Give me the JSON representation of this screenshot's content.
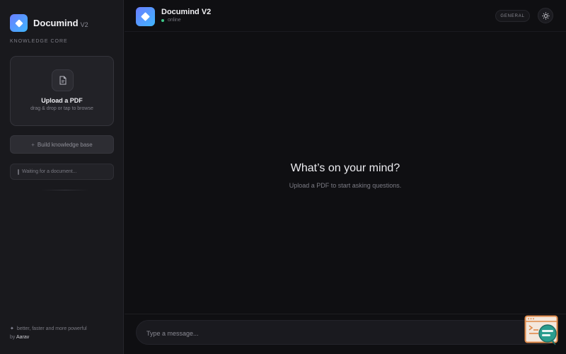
{
  "sidebar": {
    "brand_name": "Documind",
    "brand_version": "V2",
    "section_label": "KNOWLEDGE CORE",
    "upload": {
      "title": "Upload a PDF",
      "subtitle": "drag & drop or tap to browse"
    },
    "build_button_label": "Build knowledge base",
    "status_text": "Waiting for a document...",
    "footer_tagline": "better, faster and more powerful",
    "footer_by": "by",
    "footer_author": "Aarav"
  },
  "header": {
    "title": "Documind V2",
    "status": "online",
    "mode": "GENERAL"
  },
  "main": {
    "empty_title": "What’s on your mind?",
    "empty_subtitle": "Upload a PDF to start asking questions."
  },
  "composer": {
    "placeholder": "Type a message...",
    "value": ""
  },
  "icons": {
    "logo": "diamond-logo-icon",
    "upload": "file-icon",
    "build": "plus-icon",
    "theme": "sun-icon",
    "assistant": "terminal-chat-icon"
  },
  "colors": {
    "accent_gradient_start": "#6a7dff",
    "accent_gradient_end": "#3fb6ff",
    "online": "#3ec989",
    "assistant_orange": "#e08a4a",
    "assistant_teal": "#2a9d8f"
  }
}
